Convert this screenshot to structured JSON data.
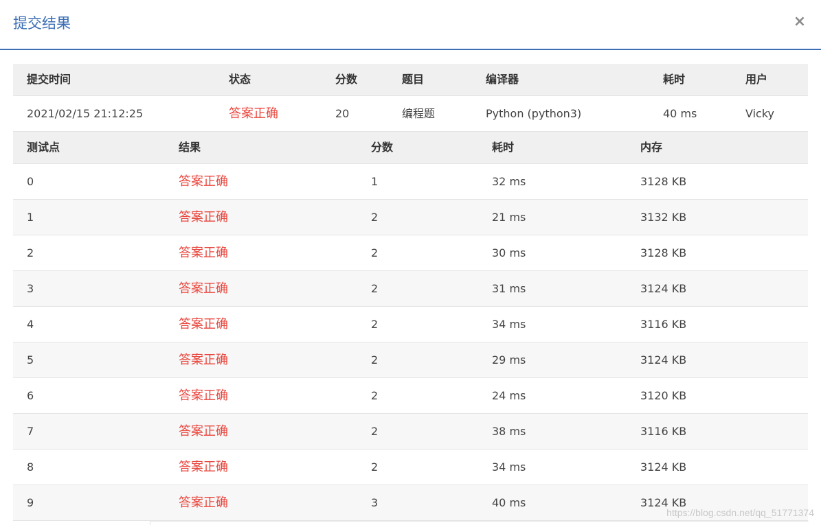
{
  "dialog": {
    "title": "提交结果",
    "close_label": "×"
  },
  "summary": {
    "headers": {
      "time": "提交时间",
      "status": "状态",
      "score": "分数",
      "problem": "题目",
      "compiler": "编译器",
      "duration": "耗时",
      "user": "用户"
    },
    "row": {
      "time": "2021/02/15 21:12:25",
      "status": "答案正确",
      "score": "20",
      "problem": "编程题",
      "compiler": "Python (python3)",
      "duration": "40 ms",
      "user": "Vicky"
    }
  },
  "tests": {
    "headers": {
      "case": "测试点",
      "result": "结果",
      "score": "分数",
      "duration": "耗时",
      "memory": "内存"
    },
    "rows": [
      {
        "case": "0",
        "result": "答案正确",
        "score": "1",
        "duration": "32 ms",
        "memory": "3128 KB"
      },
      {
        "case": "1",
        "result": "答案正确",
        "score": "2",
        "duration": "21 ms",
        "memory": "3132 KB"
      },
      {
        "case": "2",
        "result": "答案正确",
        "score": "2",
        "duration": "30 ms",
        "memory": "3128 KB"
      },
      {
        "case": "3",
        "result": "答案正确",
        "score": "2",
        "duration": "31 ms",
        "memory": "3124 KB"
      },
      {
        "case": "4",
        "result": "答案正确",
        "score": "2",
        "duration": "34 ms",
        "memory": "3116 KB"
      },
      {
        "case": "5",
        "result": "答案正确",
        "score": "2",
        "duration": "29 ms",
        "memory": "3124 KB"
      },
      {
        "case": "6",
        "result": "答案正确",
        "score": "2",
        "duration": "24 ms",
        "memory": "3120 KB"
      },
      {
        "case": "7",
        "result": "答案正确",
        "score": "2",
        "duration": "38 ms",
        "memory": "3116 KB"
      },
      {
        "case": "8",
        "result": "答案正确",
        "score": "2",
        "duration": "34 ms",
        "memory": "3124 KB"
      },
      {
        "case": "9",
        "result": "答案正确",
        "score": "3",
        "duration": "40 ms",
        "memory": "3124 KB"
      }
    ]
  },
  "watermark": "https://blog.csdn.net/qq_51771374",
  "colors": {
    "accent": "#3a6db4",
    "success": "#e8453c",
    "header_bg": "#f0f0f0",
    "stripe_bg": "#f7f7f7"
  }
}
